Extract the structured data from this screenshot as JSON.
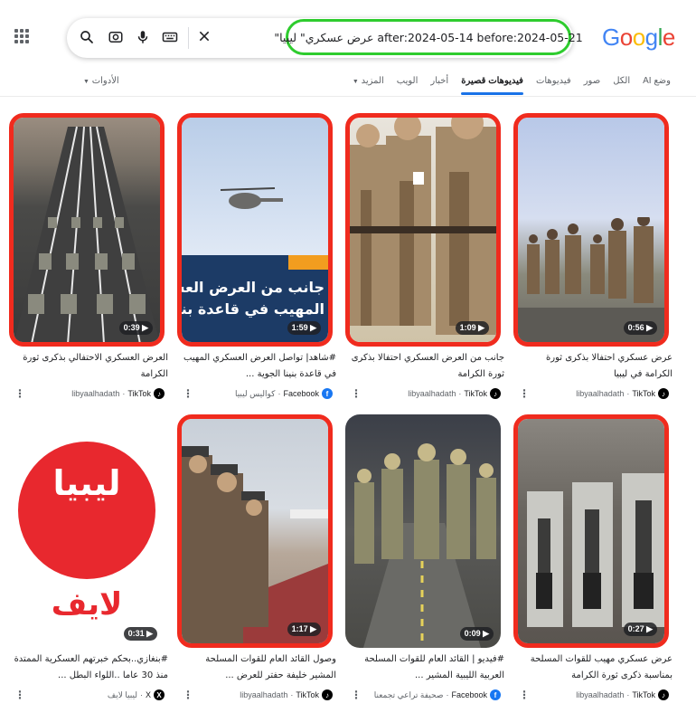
{
  "search": {
    "query": "\"عرض عسكري\" ليبيا after:2024-05-14 before:2024-05-21"
  },
  "logo": {
    "letters": [
      "G",
      "o",
      "o",
      "g",
      "l",
      "e"
    ],
    "colors": [
      "#4285F4",
      "#EA4335",
      "#FBBC05",
      "#4285F4",
      "#34A853",
      "#EA4335"
    ]
  },
  "tabs": [
    {
      "label": "وضع AI"
    },
    {
      "label": "الكل"
    },
    {
      "label": "صور"
    },
    {
      "label": "فيديوهات"
    },
    {
      "label": "فيديوهات قصيرة"
    },
    {
      "label": "أخبار"
    },
    {
      "label": "الويب"
    },
    {
      "label": "المزيد"
    }
  ],
  "tools_label": "الأدوات",
  "colors": {
    "highlight_red": "#f02b1e",
    "query_green": "#2ecc2e",
    "accent_blue": "#1a73e8"
  },
  "cards": [
    {
      "duration": "0:56",
      "title": "عرض عسكري احتفالا بذكرى ثورة الكرامة في ليبيا",
      "source": "libyaalhadath",
      "platform": "TikTok"
    },
    {
      "duration": "1:09",
      "title": "جانب من العرض العسكري احتفالا بذكرى ثورة الكرامة",
      "source": "libyaalhadath",
      "platform": "TikTok"
    },
    {
      "duration": "1:59",
      "title": "#شاهد| تواصل العرض العسكري المهيب في قاعدة بنينا الجوية ...",
      "source": "كواليس ليبيا",
      "platform": "Facebook",
      "overlay_lines": [
        "جانب من العرض العسكري",
        "المهيب في قاعدة بنينا الجو"
      ]
    },
    {
      "duration": "0:39",
      "title": "العرض العسكري الاحتفالي بذكرى ثورة الكرامة",
      "source": "libyaalhadath",
      "platform": "TikTok"
    },
    {
      "duration": "0:27",
      "title": "عرض عسكري مهيب للقوات المسلحة بمناسبة ذكرى ثورة الكرامة",
      "source": "libyaalhadath",
      "platform": "TikTok"
    },
    {
      "duration": "0:09",
      "title": "#فيديو | القائد العام للقوات المسلحة العربية الليبية المشير ...",
      "source": "صحيفة تراعي تجمعنا",
      "platform": "Facebook"
    },
    {
      "duration": "1:17",
      "title": "وصول القائد العام للقوات المسلحة المشير خليفة حفتر للعرض ...",
      "source": "libyaalhadath",
      "platform": "TikTok"
    },
    {
      "duration": "0:31",
      "title": "#بنغازي..بحكم خبرتهم العسكرية الممتدة منذ 30 عاما ..اللواء البطل ...",
      "source": "ليبيا لايف",
      "platform": "X",
      "logo_text": [
        "ليبيا",
        "لايف"
      ]
    }
  ]
}
